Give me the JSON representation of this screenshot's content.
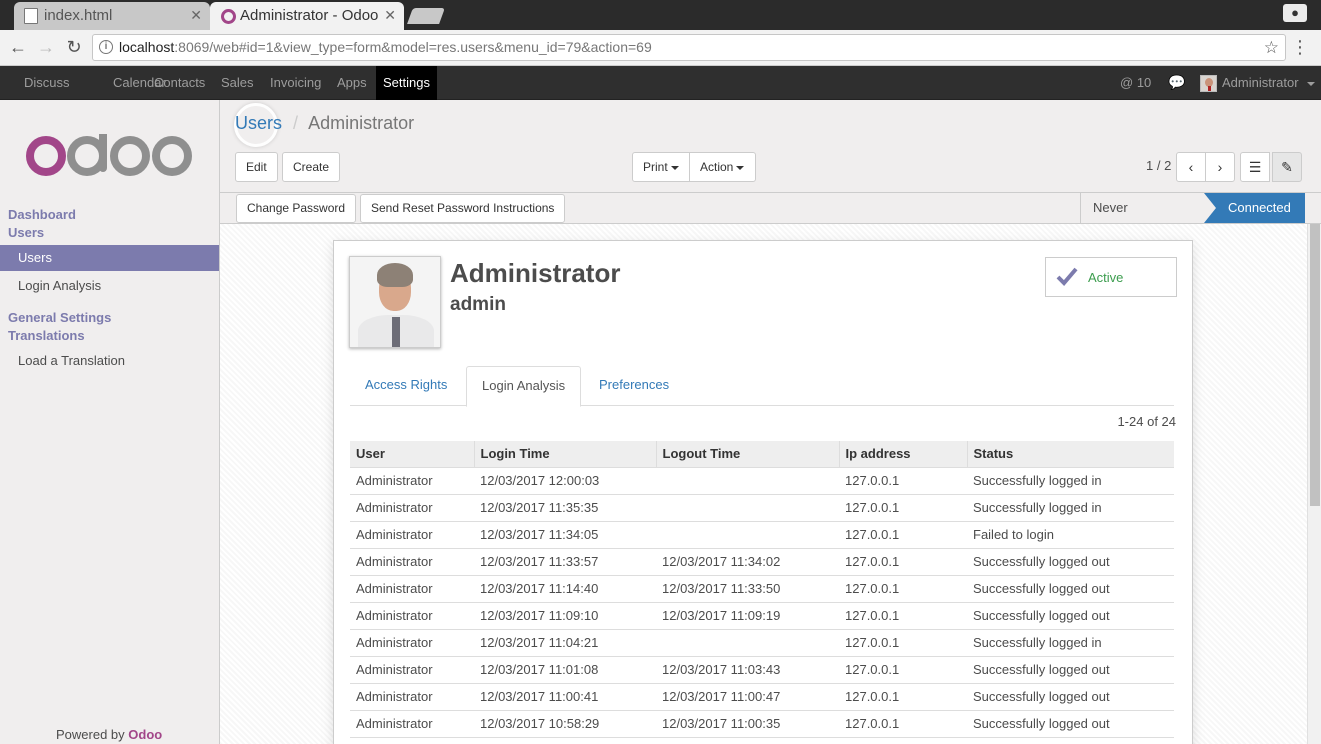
{
  "browser": {
    "tabs": [
      {
        "title": "index.html"
      },
      {
        "title": "Administrator - Odoo"
      }
    ],
    "url_host": "localhost",
    "url_rest": ":8069/web#id=1&view_type=form&model=res.users&menu_id=79&action=69"
  },
  "topnav": {
    "menus": [
      "Discuss",
      "Calendar",
      "Contacts",
      "Sales",
      "Invoicing",
      "Apps",
      "Settings"
    ],
    "active_menu": "Settings",
    "mentions_count": "10",
    "user_name": "Administrator"
  },
  "sidebar": {
    "groups": [
      {
        "label": "Dashboard"
      },
      {
        "label": "Users"
      },
      {
        "label": "General Settings"
      },
      {
        "label": "Translations"
      }
    ],
    "items": [
      {
        "label": "Users",
        "active": true
      },
      {
        "label": "Login Analysis"
      },
      {
        "label": "Load a Translation"
      }
    ],
    "powered_by": "Powered by",
    "powered_brand": "Odoo"
  },
  "control": {
    "breadcrumb_link": "Users",
    "breadcrumb_sep": "/",
    "breadcrumb_current": "Administrator",
    "edit_label": "Edit",
    "create_label": "Create",
    "print_label": "Print",
    "action_label": "Action",
    "pager": "1 / 2"
  },
  "statusbar": {
    "change_password": "Change Password",
    "send_reset": "Send Reset Password Instructions",
    "stage_never": "Never Connected",
    "stage_connected": "Connected"
  },
  "record": {
    "name": "Administrator",
    "login": "admin",
    "active_label": "Active",
    "tabs": [
      "Access Rights",
      "Login Analysis",
      "Preferences"
    ],
    "active_tab": "Login Analysis",
    "count_label": "1-24 of 24",
    "columns": [
      "User",
      "Login Time",
      "Logout Time",
      "Ip address",
      "Status"
    ],
    "rows": [
      [
        "Administrator",
        "12/03/2017 12:00:03",
        "",
        "127.0.0.1",
        "Successfully logged in"
      ],
      [
        "Administrator",
        "12/03/2017 11:35:35",
        "",
        "127.0.0.1",
        "Successfully logged in"
      ],
      [
        "Administrator",
        "12/03/2017 11:34:05",
        "",
        "127.0.0.1",
        "Failed to login"
      ],
      [
        "Administrator",
        "12/03/2017 11:33:57",
        "12/03/2017 11:34:02",
        "127.0.0.1",
        "Successfully logged out"
      ],
      [
        "Administrator",
        "12/03/2017 11:14:40",
        "12/03/2017 11:33:50",
        "127.0.0.1",
        "Successfully logged out"
      ],
      [
        "Administrator",
        "12/03/2017 11:09:10",
        "12/03/2017 11:09:19",
        "127.0.0.1",
        "Successfully logged out"
      ],
      [
        "Administrator",
        "12/03/2017 11:04:21",
        "",
        "127.0.0.1",
        "Successfully logged in"
      ],
      [
        "Administrator",
        "12/03/2017 11:01:08",
        "12/03/2017 11:03:43",
        "127.0.0.1",
        "Successfully logged out"
      ],
      [
        "Administrator",
        "12/03/2017 11:00:41",
        "12/03/2017 11:00:47",
        "127.0.0.1",
        "Successfully logged out"
      ],
      [
        "Administrator",
        "12/03/2017 10:58:29",
        "12/03/2017 11:00:35",
        "127.0.0.1",
        "Successfully logged out"
      ]
    ]
  },
  "colors": {
    "odoo_purple": "#7c7bad",
    "odoo_brand": "#a24689",
    "link_blue": "#337ab7",
    "active_green": "#3c9d4e"
  },
  "icons": [
    "info-icon",
    "star-icon",
    "back-arrow-icon",
    "forward-arrow-icon",
    "reload-icon",
    "list-view-icon",
    "form-view-icon",
    "chat-icon",
    "check-icon"
  ]
}
